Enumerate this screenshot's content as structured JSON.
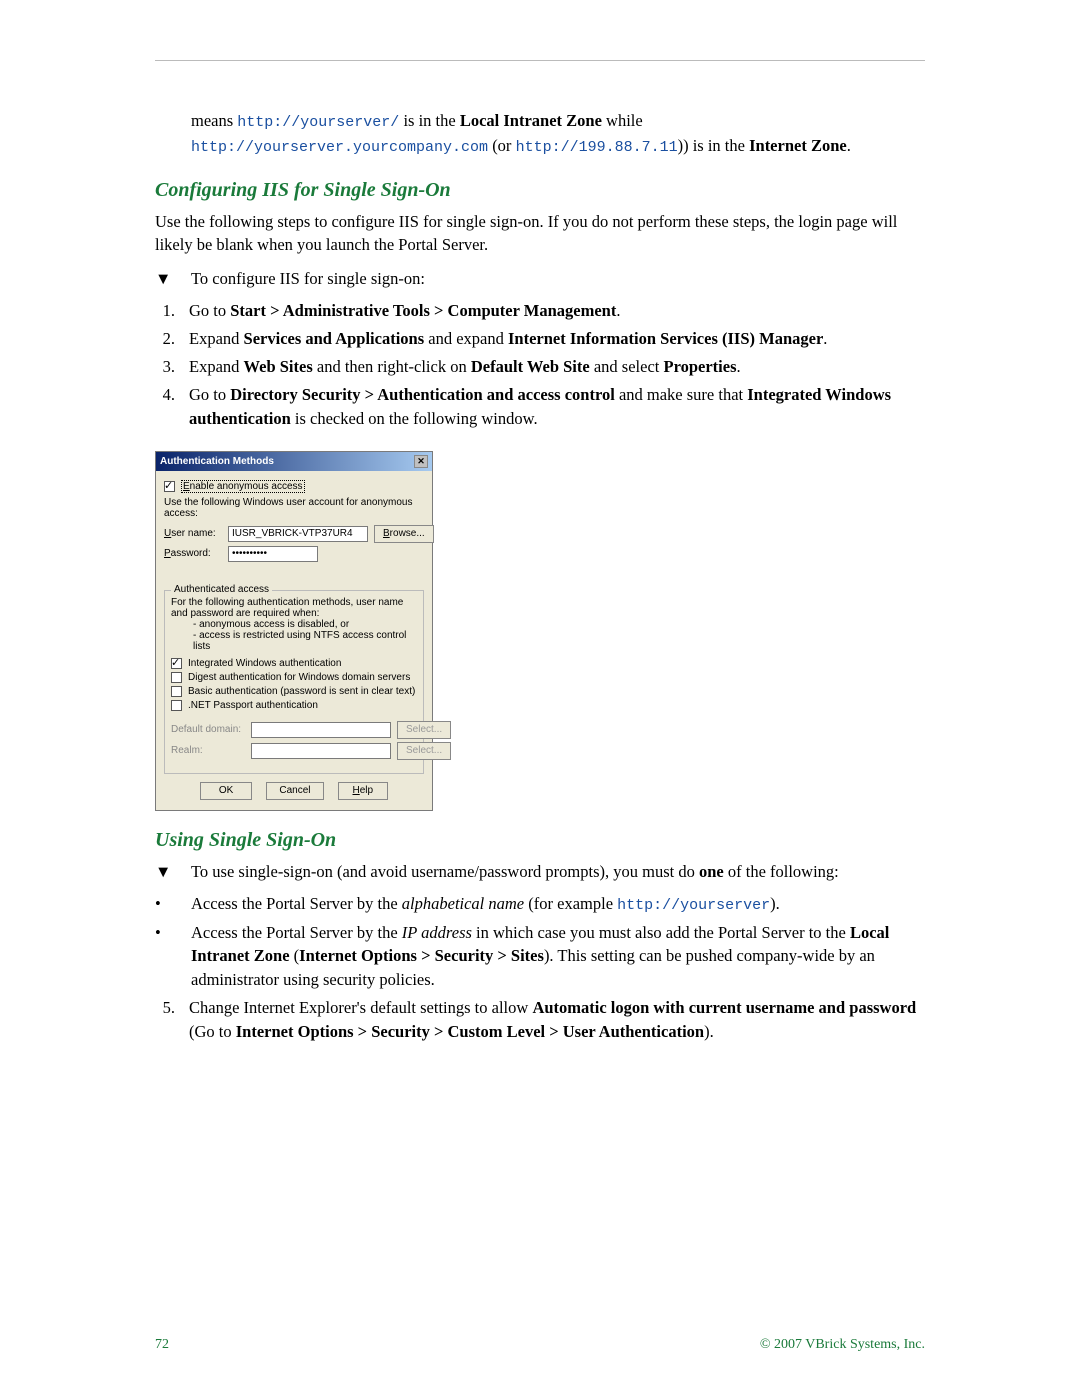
{
  "intro": {
    "t1": "means ",
    "c1": "http://yourserver/",
    "t2": " is in the ",
    "b1": "Local Intranet Zone",
    "t3": " while ",
    "c2": "http://yourserver.yourcompany.com",
    "t4": " (or ",
    "c3": "http://199.88.7.11",
    "t5": ")) is in the ",
    "b2": "Internet Zone",
    "t6": "."
  },
  "section1": {
    "heading": "Configuring IIS for Single Sign-On",
    "para": "Use the following steps to configure IIS for single sign-on. If you do not perform these steps, the login page will likely be blank when you launch the Portal Server.",
    "arrow": "To configure IIS for single sign-on:",
    "steps": {
      "s1a": "Go to ",
      "s1b": "Start > Administrative Tools > Computer Management",
      "s1c": ".",
      "s2a": "Expand ",
      "s2b": "Services and Applications",
      "s2c": " and expand ",
      "s2d": "Internet Information Services (IIS) Manager",
      "s2e": ".",
      "s3a": "Expand ",
      "s3b": "Web Sites",
      "s3c": " and then right-click on ",
      "s3d": "Default Web Site",
      "s3e": " and select ",
      "s3f": "Properties",
      "s3g": ".",
      "s4a": "Go to ",
      "s4b": "Directory Security > Authentication and access control",
      "s4c": " and make sure that ",
      "s4d": "Integrated Windows authentication",
      "s4e": " is checked on the following window."
    }
  },
  "dialog": {
    "title": "Authentication Methods",
    "enable_anon": "Enable anonymous access",
    "anon_desc": "Use the following Windows user account for anonymous access:",
    "user_label": "User name:",
    "user_value": "IUSR_VBRICK-VTP37UR4",
    "browse": "Browse...",
    "pass_label": "Password:",
    "pass_value": "••••••••••",
    "auth_legend": "Authenticated access",
    "auth_desc1": "For the following authentication methods, user name and password are required when:",
    "auth_sub1": "- anonymous access is disabled, or",
    "auth_sub2": "- access is restricted using NTFS access control lists",
    "chk1": "Integrated Windows authentication",
    "chk2": "Digest authentication for Windows domain servers",
    "chk3": "Basic authentication (password is sent in clear text)",
    "chk4": ".NET Passport authentication",
    "default_domain": "Default domain:",
    "realm": "Realm:",
    "select": "Select...",
    "ok": "OK",
    "cancel": "Cancel",
    "help": "Help"
  },
  "section2": {
    "heading": "Using Single Sign-On",
    "arrow_a": "To use single-sign-on (and avoid username/password prompts), you must do ",
    "arrow_b": "one",
    "arrow_c": " of the following:",
    "b1a": "Access the Portal Server by the ",
    "b1b": "alphabetical name",
    "b1c": " (for example ",
    "b1d": "http://yourserver",
    "b1e": ").",
    "b2a": "Access the Portal Server by the ",
    "b2b": "IP address",
    "b2c": " in which case you must also add the Portal Server to the ",
    "b2d": "Local Intranet Zone",
    "b2e": " (",
    "b2f": "Internet Options > Security > Sites",
    "b2g": "). This setting can be pushed company-wide by an administrator using security policies.",
    "s5a": "Change Internet Explorer's default settings to allow ",
    "s5b": "Automatic logon with current username and password",
    "s5c": " (Go to ",
    "s5d": "Internet Options > Security > Custom Level > User Authentication",
    "s5e": ")."
  },
  "footer": {
    "page": "72",
    "copyright": "© 2007 VBrick Systems, Inc."
  }
}
